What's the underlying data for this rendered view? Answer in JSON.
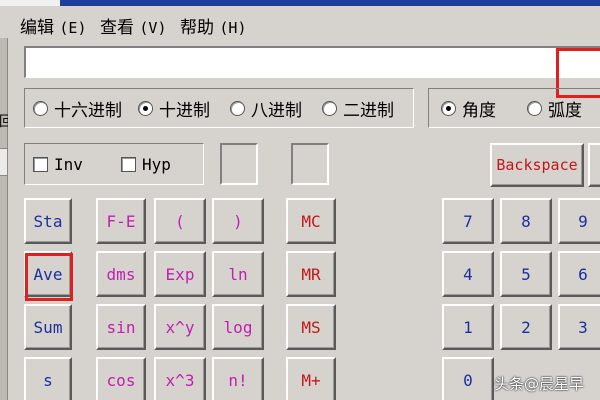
{
  "menu": [
    {
      "label": "编辑",
      "accel": "(E)"
    },
    {
      "label": "查看",
      "accel": "(V)"
    },
    {
      "label": "帮助",
      "accel": "(H)"
    }
  ],
  "left_edge_text": "回",
  "display": {
    "value": ""
  },
  "number_system": {
    "options": [
      "十六进制",
      "十进制",
      "八进制",
      "二进制"
    ],
    "selected": "十进制"
  },
  "angle_unit": {
    "options": [
      "角度",
      "弧度"
    ],
    "selected": "角度"
  },
  "checkboxes": [
    {
      "label": "Inv",
      "checked": false
    },
    {
      "label": "Hyp",
      "checked": false
    }
  ],
  "buttons": {
    "backspace": "Backspace",
    "stat": [
      "Sta",
      "Ave",
      "Sum",
      "s"
    ],
    "fn_row1": [
      "F-E",
      "(",
      ")"
    ],
    "fn_row2": [
      "dms",
      "Exp",
      "ln"
    ],
    "fn_row3": [
      "sin",
      "x^y",
      "log"
    ],
    "fn_row4": [
      "cos",
      "x^3",
      "n!"
    ],
    "memory": [
      "MC",
      "MR",
      "MS",
      "M+"
    ],
    "digits": [
      [
        "7",
        "8",
        "9"
      ],
      [
        "4",
        "5",
        "6"
      ],
      [
        "1",
        "2",
        "3"
      ],
      [
        "0"
      ]
    ]
  },
  "highlighted_button": "Ave",
  "watermark": "头条@晨星早",
  "colors": {
    "window_bg": "#d6d3ce",
    "title_strip": "#1d3d9a",
    "highlight_red": "#e02020",
    "blue_text": "#1b2fa0",
    "magenta_text": "#c020b0",
    "red_text": "#c01818"
  }
}
